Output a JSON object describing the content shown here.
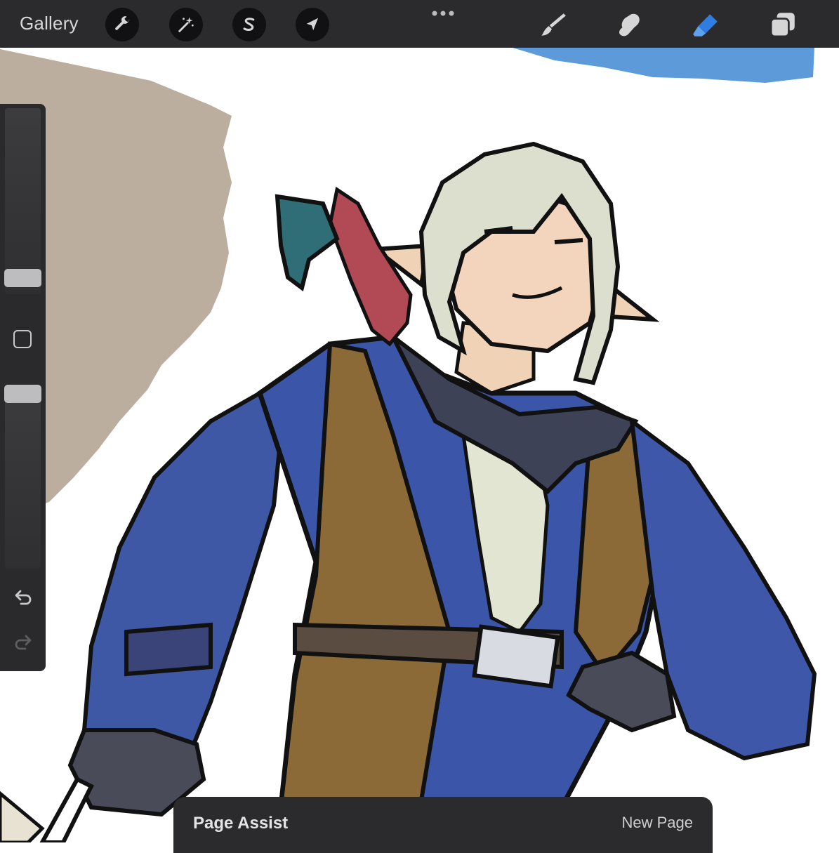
{
  "toolbar": {
    "gallery_label": "Gallery",
    "left_tools": [
      {
        "name": "actions",
        "icon": "wrench-icon"
      },
      {
        "name": "adjustments",
        "icon": "magic-wand-icon"
      },
      {
        "name": "selection",
        "icon": "selection-s-icon"
      },
      {
        "name": "transform",
        "icon": "arrow-cursor-icon"
      }
    ],
    "more_icon": "ellipsis-icon",
    "right_tools": [
      {
        "name": "brush",
        "icon": "brush-icon",
        "active": false
      },
      {
        "name": "smudge",
        "icon": "smudge-finger-icon",
        "active": false
      },
      {
        "name": "eraser",
        "icon": "eraser-icon",
        "active": true
      },
      {
        "name": "layers",
        "icon": "layers-icon",
        "active": false
      }
    ],
    "active_color": "#2f7de0",
    "icon_color": "#d6d6d6"
  },
  "sidebar": {
    "size_slider_icon": "brush-size-slider",
    "opacity_slider_icon": "opacity-slider",
    "modify_icon": "square-modify-icon",
    "undo_icon": "undo-icon",
    "redo_icon": "redo-icon"
  },
  "page_assist": {
    "title": "Page Assist",
    "new_page_label": "New Page"
  }
}
